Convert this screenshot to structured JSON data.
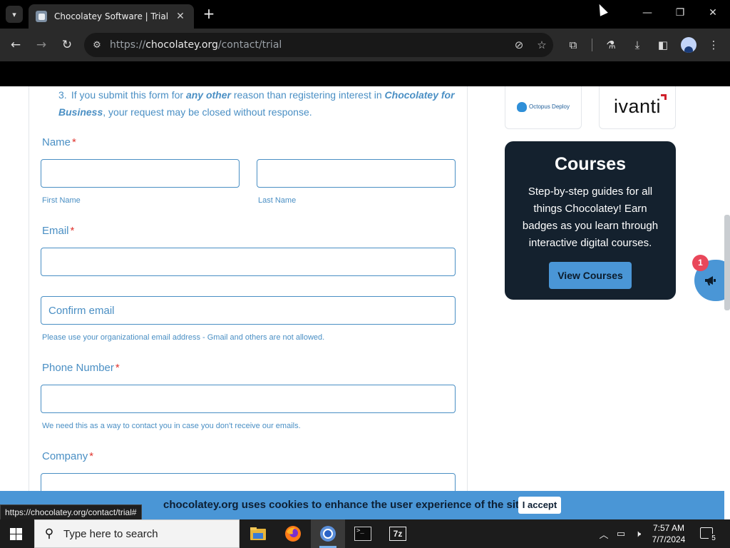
{
  "browser": {
    "tab_title": "Chocolatey Software | Trial",
    "tab_close": "✕",
    "new_tab": "+",
    "url_scheme": "https://",
    "url_domain": "chocolatey.org",
    "url_path": "/contact/trial",
    "status_url": "https://chocolatey.org/contact/trial#"
  },
  "notice": {
    "number": "3.",
    "text_before": "If you submit this form for ",
    "emph1": "any other",
    "text_middle": " reason than registering interest in ",
    "emph2": "Chocolatey for Business",
    "text_after": ", your request may be closed without response."
  },
  "form": {
    "required_mark": "*",
    "name_label": "Name",
    "first_name_help": "First Name",
    "last_name_help": "Last Name",
    "email_label": "Email",
    "confirm_email_placeholder": "Confirm email",
    "email_help": "Please use your organizational email address - Gmail and others are not allowed.",
    "phone_label": "Phone Number",
    "phone_help": "We need this as a way to contact you in case you don't receive our emails.",
    "company_label": "Company"
  },
  "sponsors": {
    "octopus": "Octopus Deploy",
    "ivanti": "ivanti"
  },
  "courses": {
    "title": "Courses",
    "description": "Step-by-step guides for all things Chocolatey! Earn badges as you learn through interactive digital courses.",
    "button": "View Courses"
  },
  "announcement": {
    "badge_count": "1"
  },
  "cookie": {
    "message": "chocolatey.org uses cookies to enhance the user experience of the site.",
    "accept": "I accept"
  },
  "taskbar": {
    "search_placeholder": "Type here to search",
    "apps": [
      "file-explorer",
      "firefox",
      "chrome",
      "terminal",
      "7zip"
    ],
    "time": "7:57 AM",
    "date": "7/7/2024",
    "notification_count": "5",
    "terminal_glyph": ">_",
    "zip_label": "7z"
  },
  "colors": {
    "accent": "#4a8fc4",
    "courses_bg": "#14212e",
    "cookie_bg": "#4a96d6",
    "required": "#e0352f",
    "badge": "#e9475a"
  }
}
